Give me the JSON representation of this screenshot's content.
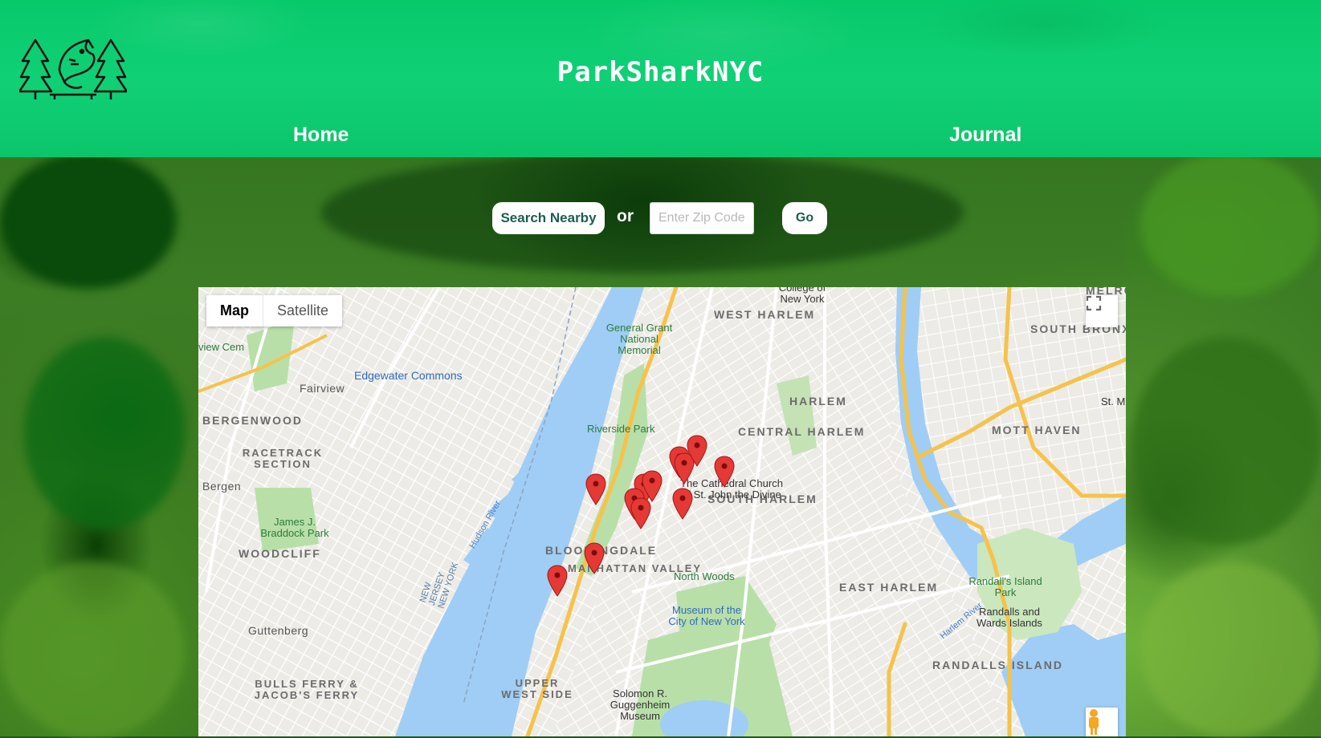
{
  "header": {
    "site_title": "ParkSharkNYC",
    "nav": [
      {
        "label": "Home"
      },
      {
        "label": "Journal"
      }
    ]
  },
  "search": {
    "nearby_label": "Search Nearby",
    "or_text": "or",
    "zip_placeholder": "Enter Zip Code",
    "zip_value": "",
    "go_label": "Go"
  },
  "map": {
    "type_controls": [
      {
        "label": "Map",
        "selected": true
      },
      {
        "label": "Satellite",
        "selected": false
      }
    ],
    "neighborhoods": [
      "WEST HARLEM",
      "HARLEM",
      "CENTRAL HARLEM",
      "SOUTH HARLEM",
      "EAST HARLEM",
      "SOUTH BRONX",
      "MOTT HAVEN",
      "RANDALLS ISLAND",
      "BLOOMINGDALE",
      "MANHATTAN VALLEY",
      "UPPER WEST SIDE",
      "BERGENWOOD",
      "RACETRACK SECTION",
      "WOODCLIFF",
      "BULLS FERRY & JACOB'S FERRY",
      "MELROSE"
    ],
    "places": [
      "Fairview",
      "Bergen",
      "Guttenberg",
      "Edgewater Commons",
      "General Grant National Memorial",
      "Riverside Park",
      "The Cathedral Church of St. John the Divine",
      "North Woods",
      "Museum of the City of New York",
      "Solomon R. Guggenheim Museum",
      "James J. Braddock Park",
      "Randall's Island Park",
      "Randalls and Wards Islands",
      "College of New York",
      "view Cem",
      "St. M"
    ],
    "water": [
      "Hudson River",
      "NEW JERSEY NEW YORK",
      "Harlem River"
    ],
    "markers_count": 12,
    "colors": {
      "marker": "#e53935",
      "water": "#9fcdf5",
      "park": "#b8dfa8",
      "header": "#0bc96c"
    }
  }
}
